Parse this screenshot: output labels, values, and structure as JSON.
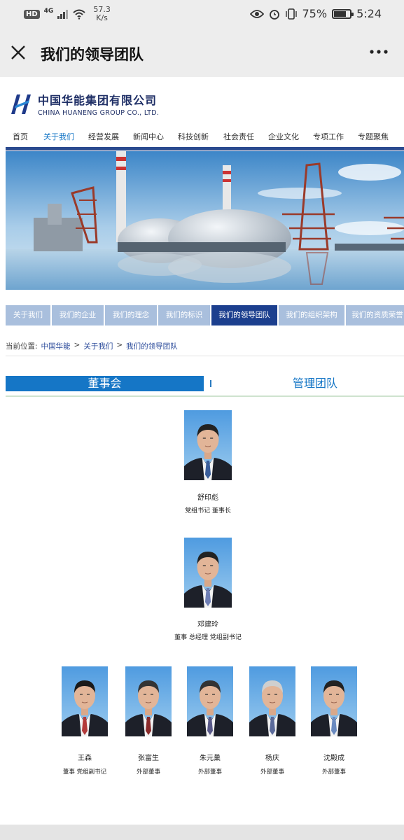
{
  "status_bar": {
    "hd": "HD",
    "network": "4G",
    "speed_value": "57.3",
    "speed_unit": "K/s",
    "battery_percent": "75%",
    "battery_level": 0.75,
    "time": "5:24"
  },
  "title_bar": {
    "title": "我们的领导团队"
  },
  "logo": {
    "cn": "中国华能集团有限公司",
    "en": "CHINA HUANENG GROUP CO., LTD."
  },
  "main_nav": [
    "首页",
    "关于我们",
    "经营发展",
    "新闻中心",
    "科技创新",
    "社会责任",
    "企业文化",
    "专项工作",
    "专题聚焦"
  ],
  "main_nav_active_index": 1,
  "sub_nav": [
    "关于我们",
    "我们的企业",
    "我们的理念",
    "我们的标识",
    "我们的领导团队",
    "我们的组织架构",
    "我们的资质荣誉"
  ],
  "sub_nav_active_index": 4,
  "breadcrumb": {
    "prefix": "当前位置:",
    "items": [
      "中国华能",
      "关于我们",
      "我们的领导团队"
    ],
    "separator": ">"
  },
  "section_tabs": {
    "board": "董事会",
    "management": "管理团队"
  },
  "people": [
    {
      "name": "舒印彪",
      "role": "党组书记 董事长"
    },
    {
      "name": "邓建玲",
      "role": "董事 总经理 党组副书记"
    },
    {
      "name": "王森",
      "role": "董事 党组副书记"
    },
    {
      "name": "张富生",
      "role": "外部董事"
    },
    {
      "name": "朱元巢",
      "role": "外部董事"
    },
    {
      "name": "杨庆",
      "role": "外部董事"
    },
    {
      "name": "沈殿成",
      "role": "外部董事"
    }
  ],
  "colors": {
    "brand_blue": "#1f2f66",
    "nav_active": "#1576c6",
    "subnav_active": "#1c3f8e",
    "subnav_inactive": "#a9bfdd",
    "photo_bg": "#5aa8e4"
  }
}
